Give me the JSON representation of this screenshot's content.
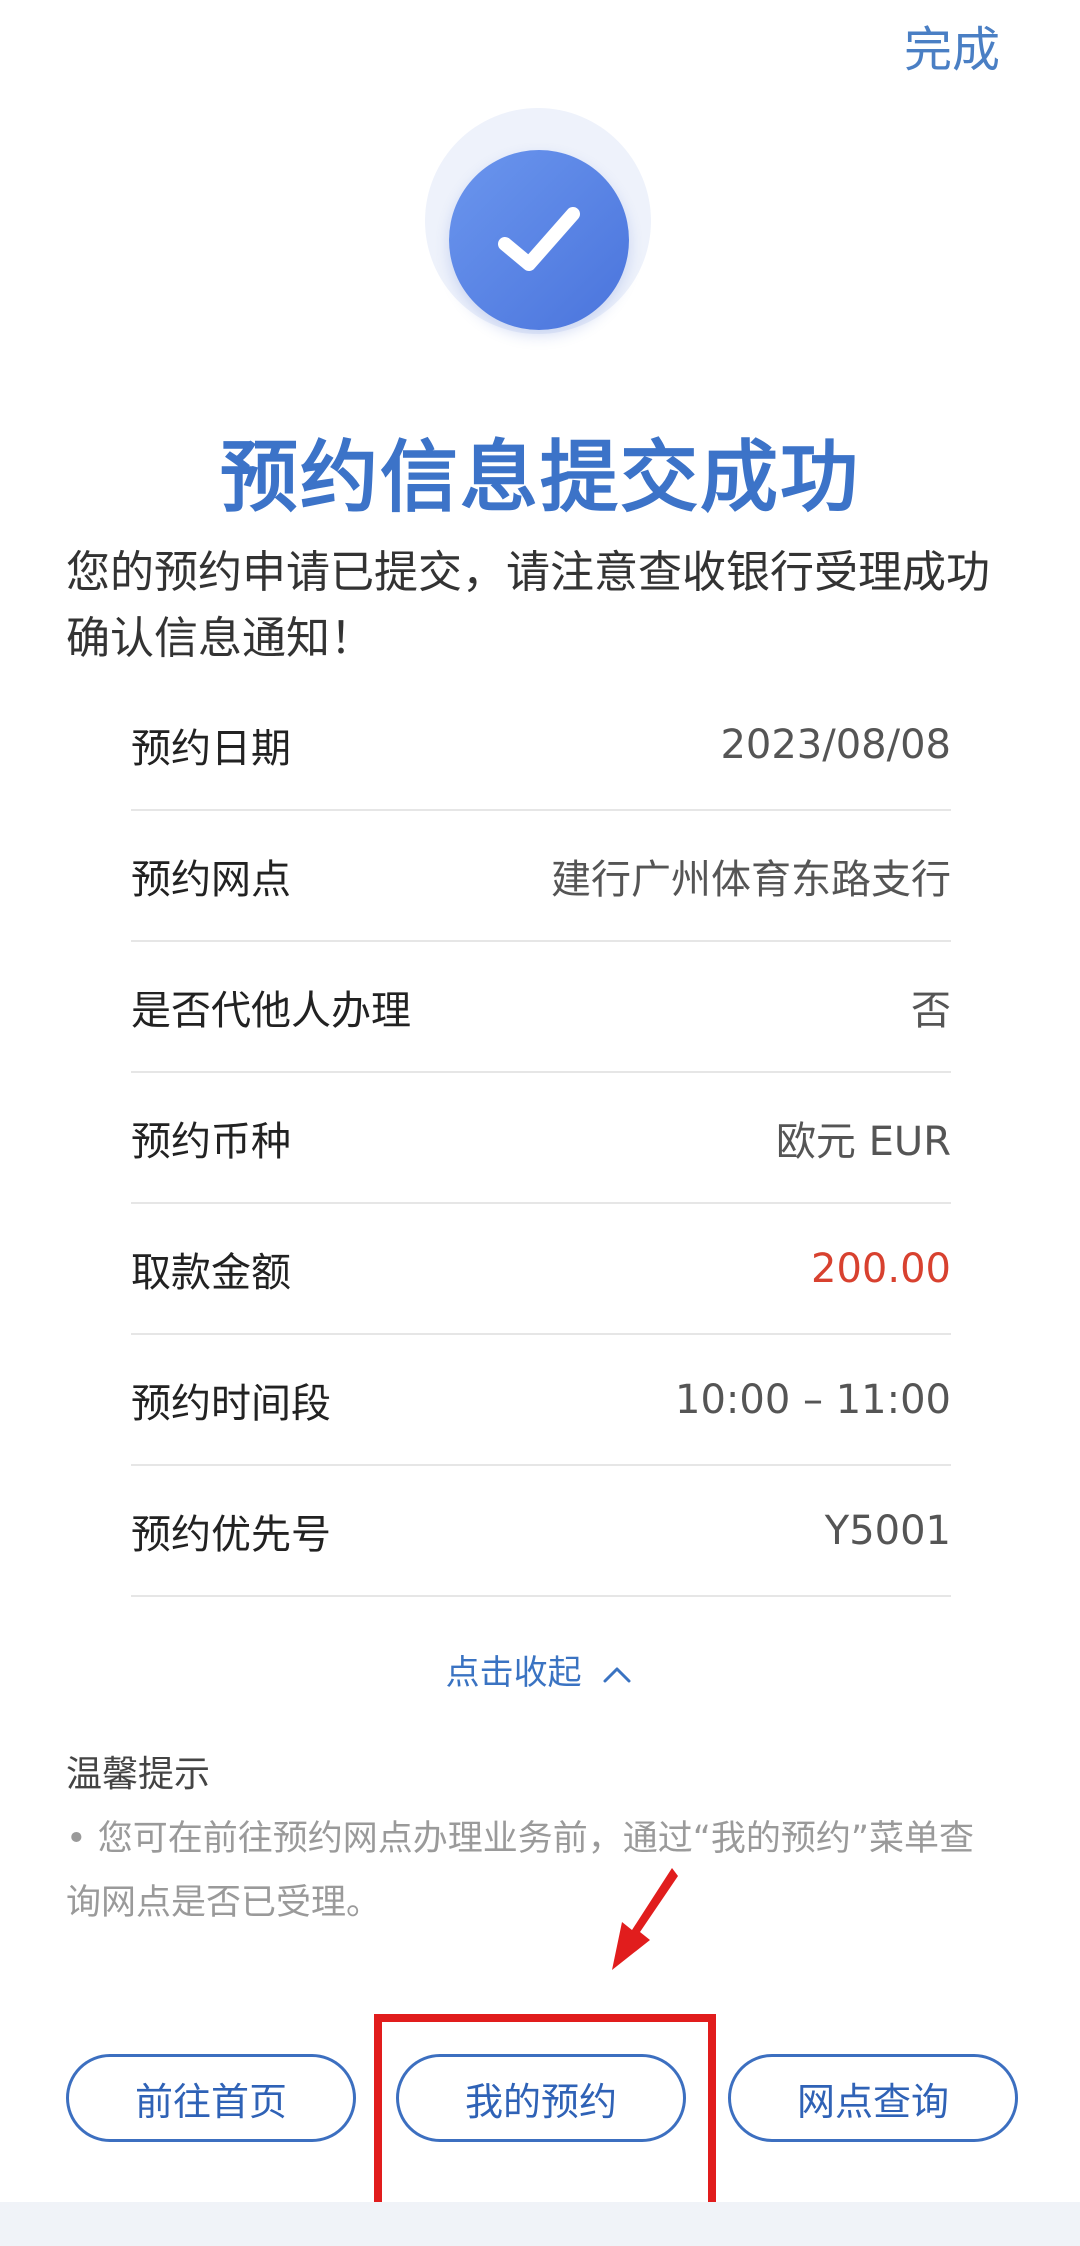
{
  "header": {
    "done_label": "完成"
  },
  "status": {
    "title": "预约信息提交成功",
    "description": "您的预约申请已提交，请注意查收银行受理成功确认信息通知！"
  },
  "details": [
    {
      "label": "预约日期",
      "value": "2023/08/08"
    },
    {
      "label": "预约网点",
      "value": "建行广州体育东路支行"
    },
    {
      "label": "是否代他人办理",
      "value": "否"
    },
    {
      "label": "预约币种",
      "value": "欧元 EUR"
    },
    {
      "label": "取款金额",
      "value": "200.00"
    },
    {
      "label": "预约时间段",
      "value": "10:00 – 11:00"
    },
    {
      "label": "预约优先号",
      "value": "Y5001"
    }
  ],
  "collapse": {
    "label": "点击收起",
    "icon": "chevron-up-icon"
  },
  "tips": {
    "title": "温馨提示",
    "text": "• 您可在前往预约网点办理业务前，通过“我的预约”菜单查询网点是否已受理。"
  },
  "actions": {
    "home_label": "前往首页",
    "my_appointment_label": "我的预约",
    "branch_query_label": "网点查询"
  },
  "colors": {
    "accent": "#3c73c8",
    "amount": "#d8412f",
    "annotation": "#e11d1d"
  }
}
